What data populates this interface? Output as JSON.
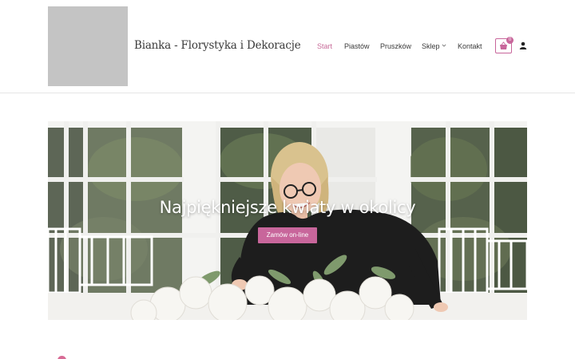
{
  "header": {
    "site_title": "Bianka - Florystyka i Dekoracje",
    "nav": [
      {
        "label": "Start",
        "active": true
      },
      {
        "label": "Piastów",
        "active": false
      },
      {
        "label": "Pruszków",
        "active": false
      },
      {
        "label": "Sklep",
        "active": false,
        "has_dropdown": true
      },
      {
        "label": "Kontakt",
        "active": false
      }
    ],
    "cart_count": "0",
    "icons": {
      "cart": "shopping-basket-icon",
      "user": "user-icon",
      "dropdown": "chevron-down-icon"
    }
  },
  "hero": {
    "title": "Najpiękniejsze kwiaty w okolicy",
    "button_label": "Zamów on-line"
  },
  "colors": {
    "accent": "#c8669b",
    "active_nav": "#c86b99",
    "text": "#3a3a3a",
    "logo_placeholder": "#c4c4c4"
  }
}
